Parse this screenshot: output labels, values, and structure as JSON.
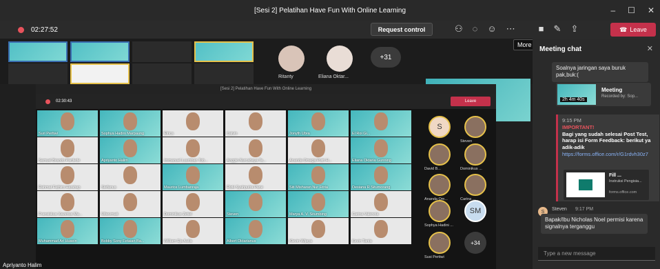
{
  "title": "[Sesi 2] Pelatihan Have Fun With Online Learning",
  "timer": "02:27:52",
  "request_control": "Request control",
  "leave": "Leave",
  "more_actions": "More actions",
  "strip": {
    "names": [
      "Ritanty",
      "Eliana Oktar..."
    ],
    "overflow": "+31"
  },
  "inner": {
    "title": "[Sesi 2] Pelatihan Have Fun With Online Learning",
    "timer": "02:30:43",
    "leave": "Leave",
    "grid": [
      "Suri Pertiwi",
      "Sophya Hadini Marpaung",
      "Elrica",
      "Calvin",
      "Jonyth Ubra",
      "El Roi Gi...",
      "Samuel Brando Pardede",
      "Apriyanto Halim",
      "Immanuel Luumban Tob...",
      "Anggio Nurcahaya Ta...",
      "Ananda Omega Putri H...",
      "Eliana Oktaria Gunning",
      "Rahmat Fathiro Harahap",
      "Stefanus",
      "Maurice Lumbanraja",
      "Rizki Syahputra Pane",
      "Siti Misharan Nur Fitria",
      "Desiana R Situmorang",
      "Fransiskus Xaverius Ma...",
      "Wbevmati",
      "Dominikus Zetiel",
      "Steven",
      "Marya A. V. Situmbing",
      "Carina Valencia",
      "Muhammad Ari Husein",
      "Bobby Sony Fetaian Ba...",
      "William Eja Aulia",
      "Albert Oktarianus",
      "Klevin Wijaya",
      "Kevin Tanta"
    ],
    "side": [
      "S",
      "Steven",
      "David B...",
      "Dominikus ...",
      "Ananda Om...",
      "Carina ...",
      "Sophya Hadini ...",
      "SM",
      "Susi Pertiwi",
      "+34"
    ]
  },
  "chat": {
    "header": "Meeting chat",
    "msg1": "Soalnya jaringan saya buruk pak,buk:(",
    "meeting_title": "Meeting",
    "meeting_sub": "Recorded by: Sop...",
    "duration": "2h 4m 40s",
    "imp_time": "9:15 PM",
    "imp_label": "IMPORTANT!",
    "imp_text": "Bagi yang sudah selesai Post Test, harap isi Form Feedback: berikut ya adik-adik",
    "imp_link": "https://forms.office.com/r/G1rdvh30z7",
    "card_title": "Fill ...",
    "card_desc": "Instruksi Pengisia...",
    "card_src": "forms.office.com",
    "steven_name": "Steven",
    "steven_time": "9:17 PM",
    "steven_msg": "Bapak/Ibu Nicholas Noel permisi karena signalnya terganggu",
    "input_placeholder": "Type a new message"
  },
  "footer_name": "Apriyanto Halim"
}
